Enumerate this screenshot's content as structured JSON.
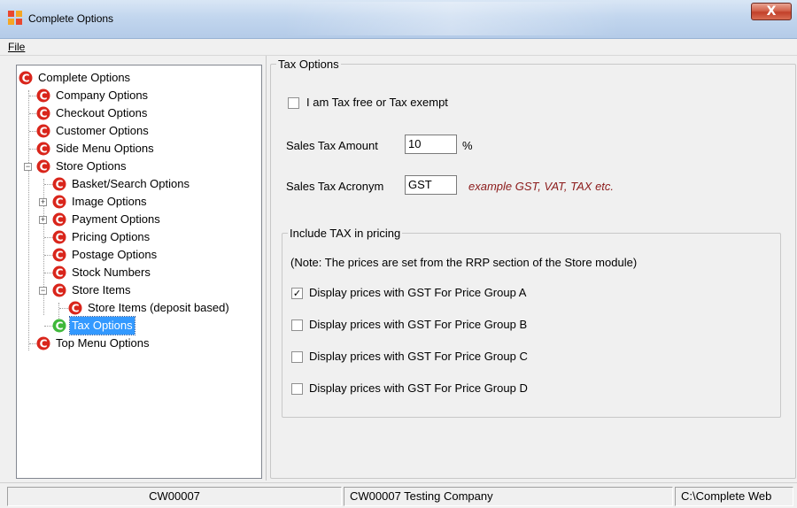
{
  "window": {
    "title": "Complete Options",
    "close_label": "X"
  },
  "menu": {
    "file_label": "File"
  },
  "tree": {
    "items": [
      {
        "label": "Complete Options",
        "icon": "c-red-icon"
      },
      {
        "label": "Company Options",
        "icon": "c-red-icon"
      },
      {
        "label": "Checkout Options",
        "icon": "c-red-icon"
      },
      {
        "label": "Customer Options",
        "icon": "c-red-icon"
      },
      {
        "label": "Side Menu Options",
        "icon": "c-red-icon"
      },
      {
        "label": "Store Options",
        "icon": "c-red-icon",
        "expanded": true
      },
      {
        "label": "Basket/Search Options",
        "icon": "c-red-icon"
      },
      {
        "label": "Image Options",
        "icon": "c-red-icon",
        "expanded": false
      },
      {
        "label": "Payment Options",
        "icon": "c-red-icon",
        "expanded": false
      },
      {
        "label": "Pricing Options",
        "icon": "c-red-icon"
      },
      {
        "label": "Postage Options",
        "icon": "c-red-icon"
      },
      {
        "label": "Stock Numbers",
        "icon": "c-red-icon"
      },
      {
        "label": "Store Items",
        "icon": "c-red-icon",
        "expanded": true
      },
      {
        "label": "Store Items (deposit based)",
        "icon": "c-red-icon"
      },
      {
        "label": "Tax Options",
        "icon": "c-green-icon",
        "selected": true
      },
      {
        "label": "Top Menu Options",
        "icon": "c-red-icon"
      }
    ]
  },
  "tax": {
    "group_title": "Tax Options",
    "exempt_label": "I am Tax free or Tax exempt",
    "exempt_checked": false,
    "amount_label": "Sales Tax Amount",
    "amount_value": "10",
    "amount_unit": "%",
    "acronym_label": "Sales Tax Acronym",
    "acronym_value": "GST",
    "acronym_hint": "example GST, VAT, TAX etc.",
    "include_group_title": "Include TAX in pricing",
    "include_note": "(Note: The prices are set from the RRP section of the Store module)",
    "price_groups": [
      {
        "label": "Display prices with GST For Price Group A",
        "checked": true
      },
      {
        "label": "Display prices with GST For Price Group B",
        "checked": false
      },
      {
        "label": "Display prices with GST For Price Group C",
        "checked": false
      },
      {
        "label": "Display prices with GST For Price Group D",
        "checked": false
      }
    ]
  },
  "status": {
    "code": "CW00007",
    "company": "CW00007 Testing Company",
    "path": "C:\\Complete Web"
  },
  "colors": {
    "selection": "#3399ff",
    "hint": "#8b1a1a",
    "c_icon_red": "#d9251b",
    "c_icon_green": "#3fb83a"
  }
}
